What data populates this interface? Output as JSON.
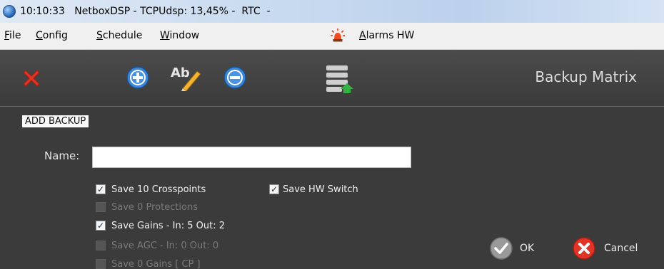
{
  "window": {
    "title": "10:10:33   NetboxDSP - TCPUdsp: 13,45% -  RTC  -"
  },
  "menu": {
    "items": [
      {
        "first": "F",
        "rest": "ile"
      },
      {
        "first": "C",
        "rest": "onfig"
      },
      {
        "first": "S",
        "rest": "chedule"
      },
      {
        "first": "W",
        "rest": "indow"
      }
    ],
    "alarms": {
      "first": "A",
      "rest": "larms HW"
    }
  },
  "toolbar": {
    "title": "Backup Matrix",
    "tools": [
      "close-icon",
      "add-icon",
      "rename-icon",
      "remove-icon",
      "database-upload-icon"
    ],
    "rename_glyph": "Ab"
  },
  "form": {
    "section_label": "ADD BACKUP",
    "name_label": "Name:",
    "name_value": "",
    "checkboxes": [
      {
        "label": "Save  10  Crosspoints",
        "checked": true,
        "enabled": true
      },
      {
        "label": "Save HW Switch",
        "checked": true,
        "enabled": true
      },
      {
        "label": "Save  0  Protections",
        "checked": false,
        "enabled": false
      },
      {
        "label": "Save Gains - In: 5  Out: 2",
        "checked": true,
        "enabled": true
      },
      {
        "label": "Save AGC - In: 0  Out: 0",
        "checked": false,
        "enabled": false
      },
      {
        "label": "Save  0  Gains [ CP ]",
        "checked": false,
        "enabled": false
      }
    ],
    "ok_label": "OK",
    "cancel_label": "Cancel"
  },
  "colors": {
    "accent_blue": "#3b86d6",
    "close_red": "#e03526",
    "ok_gray": "#9a9a9a"
  }
}
